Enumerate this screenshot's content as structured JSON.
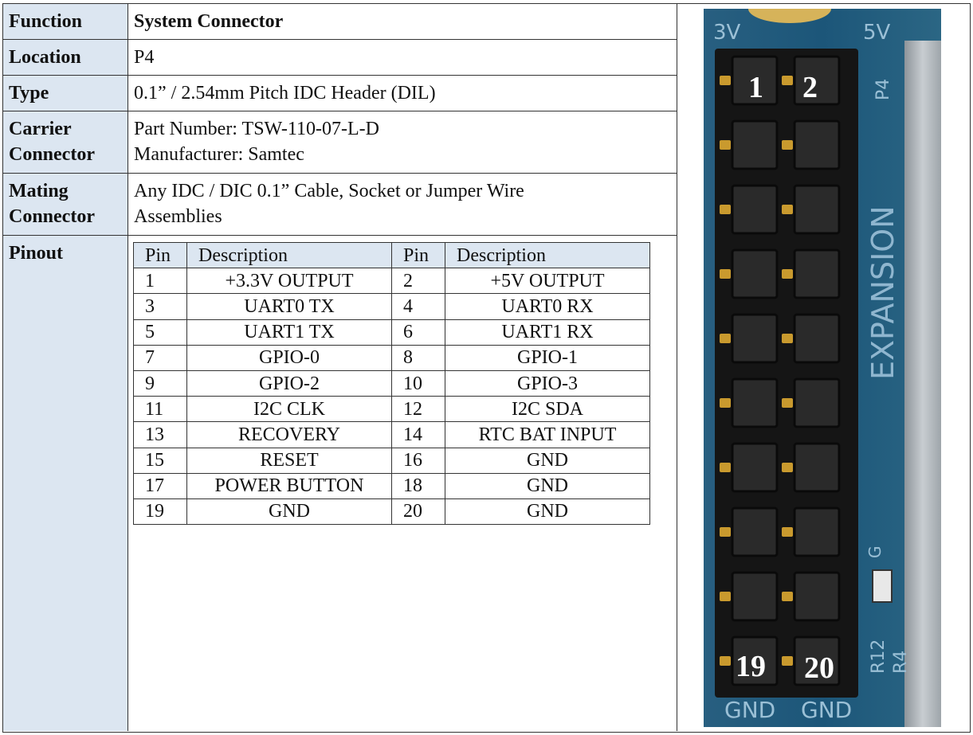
{
  "spec": {
    "function": {
      "label": "Function",
      "value": "System Connector"
    },
    "location": {
      "label": "Location",
      "value": "P4"
    },
    "type": {
      "label": "Type",
      "value": "0.1” / 2.54mm Pitch IDC Header (DIL)"
    },
    "carrier": {
      "label_line1": "Carrier",
      "label_line2": "Connector",
      "value_line1": "Part Number: TSW-110-07-L-D",
      "value_line2": "Manufacturer: Samtec"
    },
    "mating": {
      "label_line1": "Mating",
      "label_line2": "Connector",
      "value_line1": "Any IDC / DIC 0.1” Cable, Socket or Jumper Wire",
      "value_line2": "Assemblies"
    },
    "pinout": {
      "label": "Pinout"
    }
  },
  "pin_table": {
    "headers": [
      "Pin",
      "Description",
      "Pin",
      "Description"
    ],
    "rows": [
      [
        "1",
        "+3.3V OUTPUT",
        "2",
        "+5V OUTPUT"
      ],
      [
        "3",
        "UART0 TX",
        "4",
        "UART0 RX"
      ],
      [
        "5",
        "UART1 TX",
        "6",
        "UART1 RX"
      ],
      [
        "7",
        "GPIO-0",
        "8",
        "GPIO-1"
      ],
      [
        "9",
        "GPIO-2",
        "10",
        "GPIO-3"
      ],
      [
        "11",
        "I2C CLK",
        "12",
        "I2C SDA"
      ],
      [
        "13",
        "RECOVERY",
        "14",
        "RTC BAT INPUT"
      ],
      [
        "15",
        "RESET",
        "16",
        "GND"
      ],
      [
        "17",
        "POWER BUTTON",
        "18",
        "GND"
      ],
      [
        "19",
        "GND",
        "20",
        "GND"
      ]
    ]
  },
  "photo": {
    "silk_3v": "3V",
    "silk_5v": "5V",
    "silk_p4": "P4",
    "silk_expansion": "EXPANSION",
    "pin_label_1": "1",
    "pin_label_2": "2",
    "pin_label_19": "19",
    "pin_label_20": "20",
    "silk_gnd_left": "GND",
    "silk_gnd_right": "GND",
    "silk_r12": "R12",
    "silk_r4": "R4",
    "silk_g": "G",
    "board_color": "#1e5a7d",
    "header_color": "#1c1c1c",
    "pin_color": "#c99a2e"
  }
}
